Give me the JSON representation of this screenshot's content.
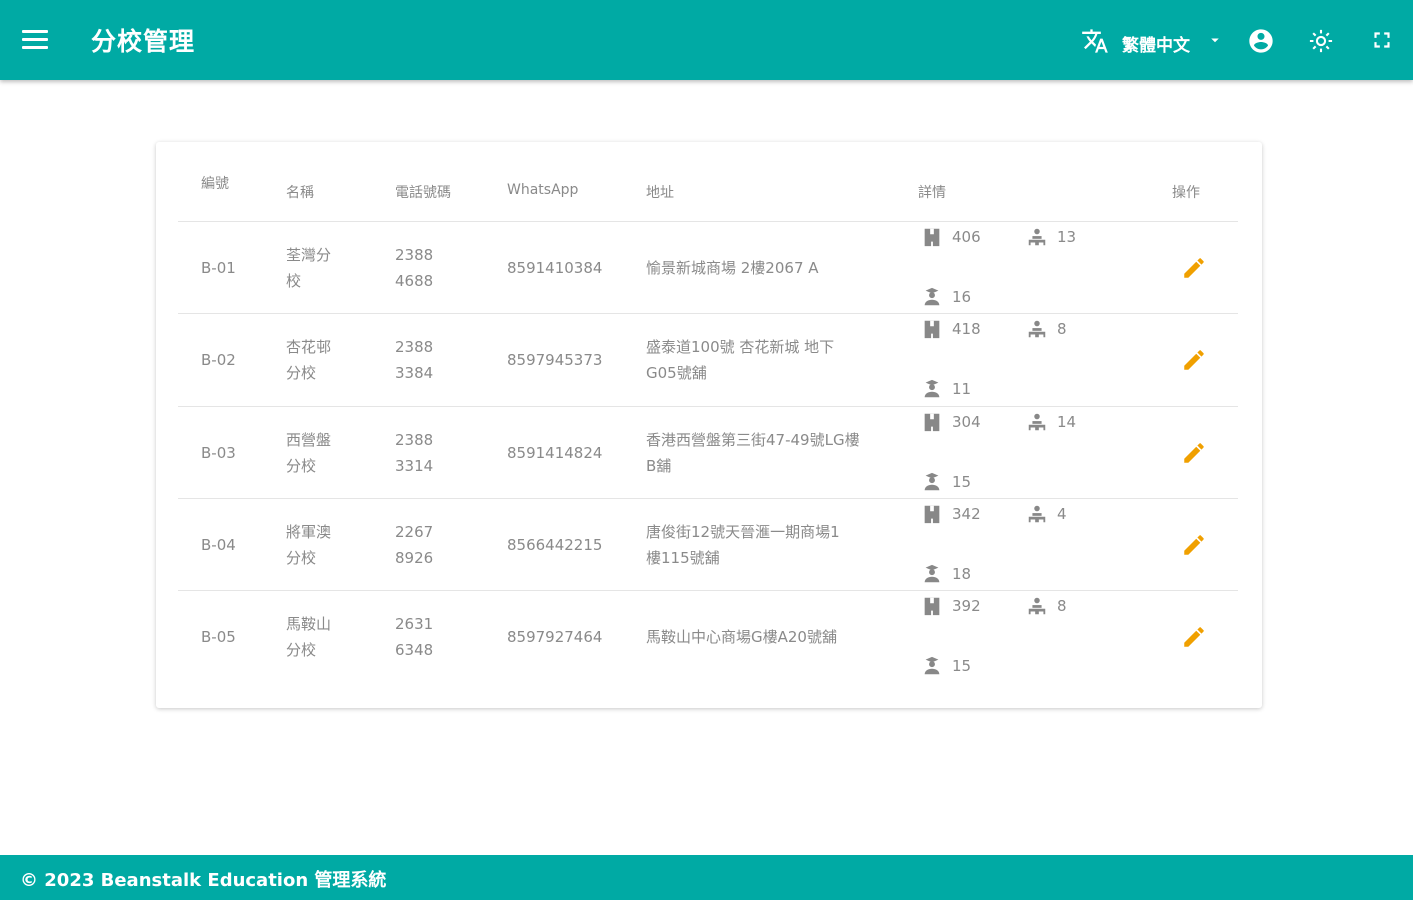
{
  "header": {
    "title": "分校管理",
    "language": "繁體中文",
    "icons": [
      "menu-icon",
      "translate-icon",
      "dropdown-arrow-icon",
      "account-circle-icon",
      "settings-icon",
      "fullscreen-icon"
    ]
  },
  "table": {
    "columns": [
      "編號",
      "名稱",
      "電話號碼",
      "WhatsApp",
      "地址",
      "詳情",
      "操作"
    ],
    "rows": [
      {
        "id": "B-01",
        "name": [
          "荃灣分",
          "校"
        ],
        "phone": [
          "2388",
          "4688"
        ],
        "whatsapp": "8591410384",
        "address": [
          "愉景新城商場 2樓2067 A"
        ],
        "stats": {
          "rooms": "406",
          "teachers": "13",
          "students": "16"
        }
      },
      {
        "id": "B-02",
        "name": [
          "杏花邨",
          "分校"
        ],
        "phone": [
          "2388",
          "3384"
        ],
        "whatsapp": "8597945373",
        "address": [
          "盛泰道100號 杏花新城 地下",
          "G05號舖"
        ],
        "stats": {
          "rooms": "418",
          "teachers": "8",
          "students": "11"
        }
      },
      {
        "id": "B-03",
        "name": [
          "西營盤",
          "分校"
        ],
        "phone": [
          "2388",
          "3314"
        ],
        "whatsapp": "8591414824",
        "address": [
          "香港西營盤第三街47-49號LG樓",
          "B舖"
        ],
        "stats": {
          "rooms": "304",
          "teachers": "14",
          "students": "15"
        }
      },
      {
        "id": "B-04",
        "name": [
          "將軍澳",
          "分校"
        ],
        "phone": [
          "2267",
          "8926"
        ],
        "whatsapp": "8566442215",
        "address": [
          "唐俊街12號天晉滙一期商場1",
          "樓115號舖"
        ],
        "stats": {
          "rooms": "342",
          "teachers": "4",
          "students": "18"
        }
      },
      {
        "id": "B-05",
        "name": [
          "馬鞍山",
          "分校"
        ],
        "phone": [
          "2631",
          "6348"
        ],
        "whatsapp": "8597927464",
        "address": [
          "馬鞍山中心商場G樓A20號舖"
        ],
        "stats": {
          "rooms": "392",
          "teachers": "8",
          "students": "15"
        }
      }
    ]
  },
  "footer": {
    "text": "© 2023 Beanstalk Education 管理系統"
  },
  "colors": {
    "primary": "#00aaa4",
    "accent": "#f0a000",
    "text": "#8a8a8a",
    "icon": "#888888"
  }
}
